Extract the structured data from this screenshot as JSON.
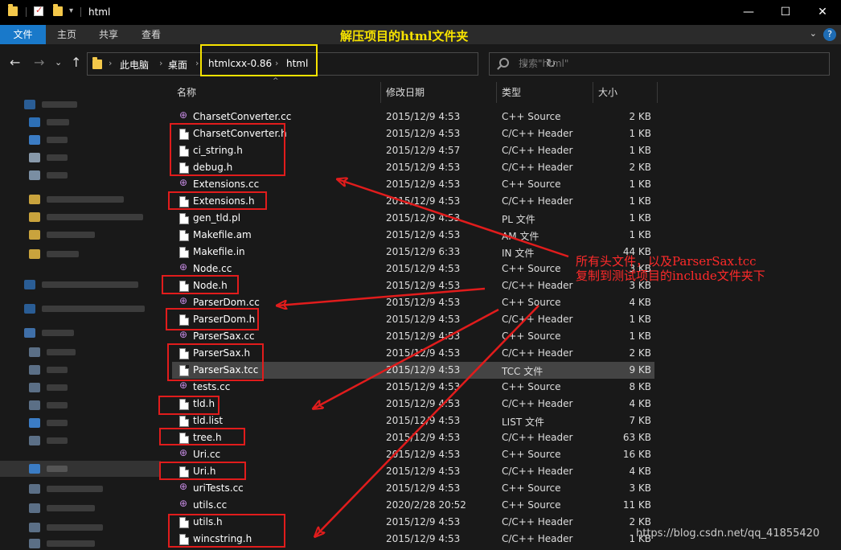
{
  "window": {
    "title": "html",
    "min_glyph": "—",
    "max_glyph": "☐",
    "close_glyph": "✕"
  },
  "ribbon": {
    "tabs": [
      "文件",
      "主页",
      "共享",
      "查看"
    ],
    "annotation": "解压项目的html文件夹",
    "help_glyph": "?",
    "expand_glyph": "⌄"
  },
  "nav": {
    "back_glyph": "←",
    "forward_glyph": "→",
    "recent_glyph": "⌄",
    "up_glyph": "↑",
    "breadcrumb": [
      "此电脑",
      "桌面",
      "htmlcxx-0.86",
      "html"
    ],
    "crumb_sep": "›",
    "dropdown_glyph": "⌄",
    "refresh_glyph": "↻",
    "search_placeholder": "搜索\"html\""
  },
  "columns": {
    "name": "名称",
    "date": "修改日期",
    "type": "类型",
    "size": "大小",
    "sort_glyph": "^"
  },
  "files": [
    {
      "name": "CharsetConverter.cc",
      "date": "2015/12/9 4:53",
      "type": "C++ Source",
      "size": "2 KB",
      "icon": "cpp-icon"
    },
    {
      "name": "CharsetConverter.h",
      "date": "2015/12/9 4:53",
      "type": "C/C++ Header",
      "size": "1 KB",
      "icon": "header-icon"
    },
    {
      "name": "ci_string.h",
      "date": "2015/12/9 4:57",
      "type": "C/C++ Header",
      "size": "1 KB",
      "icon": "header-icon"
    },
    {
      "name": "debug.h",
      "date": "2015/12/9 4:53",
      "type": "C/C++ Header",
      "size": "2 KB",
      "icon": "header-icon"
    },
    {
      "name": "Extensions.cc",
      "date": "2015/12/9 4:53",
      "type": "C++ Source",
      "size": "1 KB",
      "icon": "cpp-icon"
    },
    {
      "name": "Extensions.h",
      "date": "2015/12/9 4:53",
      "type": "C/C++ Header",
      "size": "1 KB",
      "icon": "header-icon"
    },
    {
      "name": "gen_tld.pl",
      "date": "2015/12/9 4:53",
      "type": "PL 文件",
      "size": "1 KB",
      "icon": "file-icon"
    },
    {
      "name": "Makefile.am",
      "date": "2015/12/9 4:53",
      "type": "AM 文件",
      "size": "1 KB",
      "icon": "file-icon"
    },
    {
      "name": "Makefile.in",
      "date": "2015/12/9 6:33",
      "type": "IN 文件",
      "size": "44 KB",
      "icon": "file-icon"
    },
    {
      "name": "Node.cc",
      "date": "2015/12/9 4:53",
      "type": "C++ Source",
      "size": "3 KB",
      "icon": "cpp-icon"
    },
    {
      "name": "Node.h",
      "date": "2015/12/9 4:53",
      "type": "C/C++ Header",
      "size": "3 KB",
      "icon": "header-icon"
    },
    {
      "name": "ParserDom.cc",
      "date": "2015/12/9 4:53",
      "type": "C++ Source",
      "size": "4 KB",
      "icon": "cpp-icon"
    },
    {
      "name": "ParserDom.h",
      "date": "2015/12/9 4:53",
      "type": "C/C++ Header",
      "size": "1 KB",
      "icon": "header-icon"
    },
    {
      "name": "ParserSax.cc",
      "date": "2015/12/9 4:53",
      "type": "C++ Source",
      "size": "1 KB",
      "icon": "cpp-icon"
    },
    {
      "name": "ParserSax.h",
      "date": "2015/12/9 4:53",
      "type": "C/C++ Header",
      "size": "2 KB",
      "icon": "header-icon"
    },
    {
      "name": "ParserSax.tcc",
      "date": "2015/12/9 4:53",
      "type": "TCC 文件",
      "size": "9 KB",
      "icon": "file-icon"
    },
    {
      "name": "tests.cc",
      "date": "2015/12/9 4:53",
      "type": "C++ Source",
      "size": "8 KB",
      "icon": "cpp-icon"
    },
    {
      "name": "tld.h",
      "date": "2015/12/9 4:53",
      "type": "C/C++ Header",
      "size": "4 KB",
      "icon": "header-icon"
    },
    {
      "name": "tld.list",
      "date": "2015/12/9 4:53",
      "type": "LIST 文件",
      "size": "7 KB",
      "icon": "file-icon"
    },
    {
      "name": "tree.h",
      "date": "2015/12/9 4:53",
      "type": "C/C++ Header",
      "size": "63 KB",
      "icon": "header-icon"
    },
    {
      "name": "Uri.cc",
      "date": "2015/12/9 4:53",
      "type": "C++ Source",
      "size": "16 KB",
      "icon": "cpp-icon"
    },
    {
      "name": "Uri.h",
      "date": "2015/12/9 4:53",
      "type": "C/C++ Header",
      "size": "4 KB",
      "icon": "header-icon"
    },
    {
      "name": "uriTests.cc",
      "date": "2015/12/9 4:53",
      "type": "C++ Source",
      "size": "3 KB",
      "icon": "cpp-icon"
    },
    {
      "name": "utils.cc",
      "date": "2020/2/28 20:52",
      "type": "C++ Source",
      "size": "11 KB",
      "icon": "cpp-icon"
    },
    {
      "name": "utils.h",
      "date": "2015/12/9 4:53",
      "type": "C/C++ Header",
      "size": "2 KB",
      "icon": "header-icon"
    },
    {
      "name": "wincstring.h",
      "date": "2015/12/9 4:53",
      "type": "C/C++ Header",
      "size": "1 KB",
      "icon": "header-icon"
    }
  ],
  "selected_file": "ParserSax.tcc",
  "annotation": {
    "line1": "所有头文件，以及ParserSax.tcc",
    "line2": "复制到测试项目的include文件夹下",
    "color": "#ff2a2a",
    "highlight_color": "#f7e300"
  },
  "watermark": "https://blog.csdn.net/qq_41855420"
}
